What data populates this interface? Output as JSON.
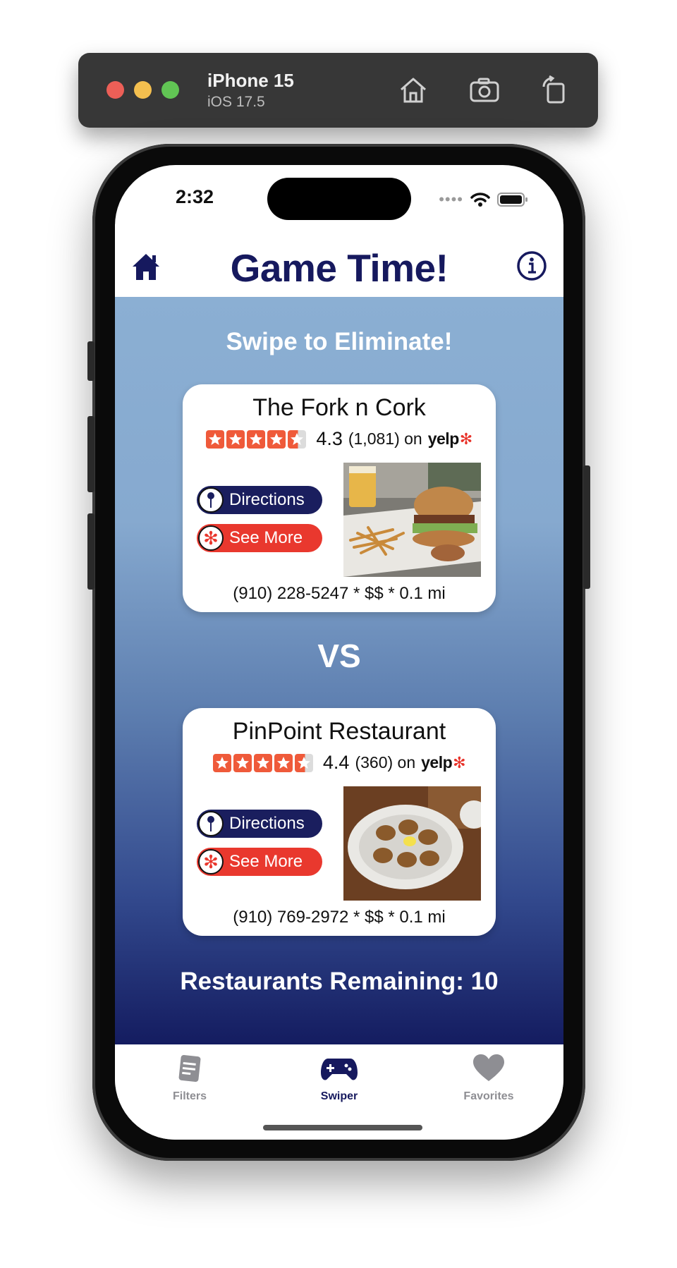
{
  "simulator": {
    "device_name": "iPhone 15",
    "os_version": "iOS 17.5",
    "buttons": [
      "home-icon",
      "screenshot-camera-icon",
      "rotate-icon"
    ]
  },
  "status_bar": {
    "time": "2:32",
    "icons": [
      "signal-dots-icon",
      "wifi-icon",
      "battery-icon"
    ]
  },
  "header": {
    "title": "Game Time!",
    "left_icon": "house-icon",
    "right_icon": "info-icon"
  },
  "main": {
    "swipe_label": "Swipe to Eliminate!",
    "vs_label": "VS",
    "remaining_label": "Restaurants Remaining: 10"
  },
  "cards": [
    {
      "name": "The Fork n Cork",
      "rating": "4.3",
      "review_count": "(1,081) on",
      "stars_value": 4.3,
      "yelp_logo": "yelp",
      "directions_label": "Directions",
      "see_more_label": "See More",
      "footer": "(910) 228-5247  *  $$  *  0.1 mi",
      "photo": "burger-and-fries-photo"
    },
    {
      "name": "PinPoint Restaurant",
      "rating": "4.4",
      "review_count": "(360) on",
      "stars_value": 4.4,
      "yelp_logo": "yelp",
      "directions_label": "Directions",
      "see_more_label": "See More",
      "footer": "(910) 769-2972  *  $$  *  0.1 mi",
      "photo": "baked-oysters-photo"
    }
  ],
  "tabbar": {
    "tabs": [
      {
        "label": "Filters",
        "icon": "document-icon",
        "active": false
      },
      {
        "label": "Swiper",
        "icon": "gamepad-icon",
        "active": true
      },
      {
        "label": "Favorites",
        "icon": "heart-icon",
        "active": false
      }
    ]
  },
  "colors": {
    "accent_navy": "#16195e",
    "yelp_red": "#e9382e",
    "inactive_tab": "#8e8e93",
    "gradient_top": "#8bafd3",
    "gradient_bottom": "#141c60"
  }
}
